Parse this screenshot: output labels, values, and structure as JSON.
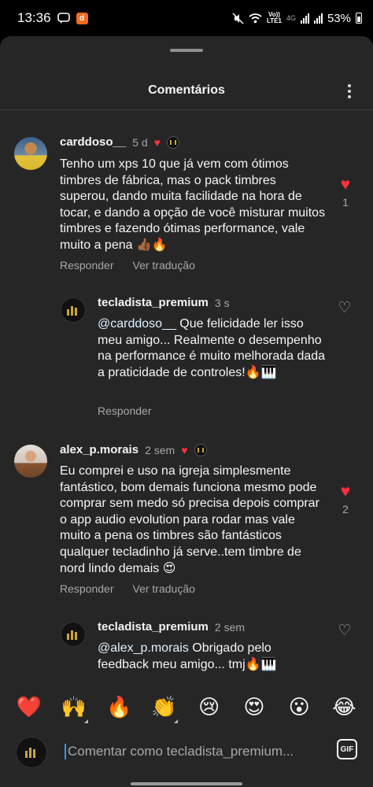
{
  "status_bar": {
    "time": "13:36",
    "app_badge": "d",
    "volte_line1": "Vo))",
    "volte_line2": "LTE1",
    "network": "4G",
    "battery": "53%"
  },
  "sheet": {
    "title": "Comentários"
  },
  "comments": [
    {
      "username": "carddoso__",
      "time": "5 d",
      "text": "Tenho um xps 10 que já vem com  ótimos timbres de fábrica, mas o pack timbres superou, dando muita facilidade na hora de tocar, e dando a opção de você misturar muitos timbres e fazendo ótimas performance, vale muito a pena 👍🏾🔥",
      "reply_label": "Responder",
      "translate_label": "Ver tradução",
      "likes": "1",
      "liked": true
    },
    {
      "username": "tecladista_premium",
      "time": "3 s",
      "mention": "@carddoso__",
      "text": " Que felicidade ler isso meu amigo... Realmente o desempenho na performance é muito melhorada dada a praticidade de controles!🔥🎹",
      "reply_label": "Responder",
      "liked": false
    },
    {
      "username": "alex_p.morais",
      "time": "2 sem",
      "text": "Eu comprei e uso na igreja simplesmente fantástico, bom demais funciona mesmo pode comprar sem medo só precisa depois comprar o app audio evolution para rodar mas vale muito a pena os timbres são fantásticos qualquer tecladinho já serve..tem timbre de nord lindo demais 😍",
      "reply_label": "Responder",
      "translate_label": "Ver tradução",
      "likes": "2",
      "liked": true
    },
    {
      "username": "tecladista_premium",
      "time": "2 sem",
      "mention": "@alex_p.morais",
      "text": " Obrigado pelo feedback meu amigo... tmj🔥🎹",
      "liked": false
    }
  ],
  "reactions": [
    "❤️",
    "🙌",
    "🔥",
    "👏",
    "😢",
    "😍",
    "😮",
    "😂"
  ],
  "composer": {
    "placeholder": "Comentar como tecladista_premium...",
    "gif_label": "GIF"
  },
  "icons": {
    "heart_filled": "♥",
    "heart_outline": "♡",
    "color_like": "#ff3040"
  }
}
